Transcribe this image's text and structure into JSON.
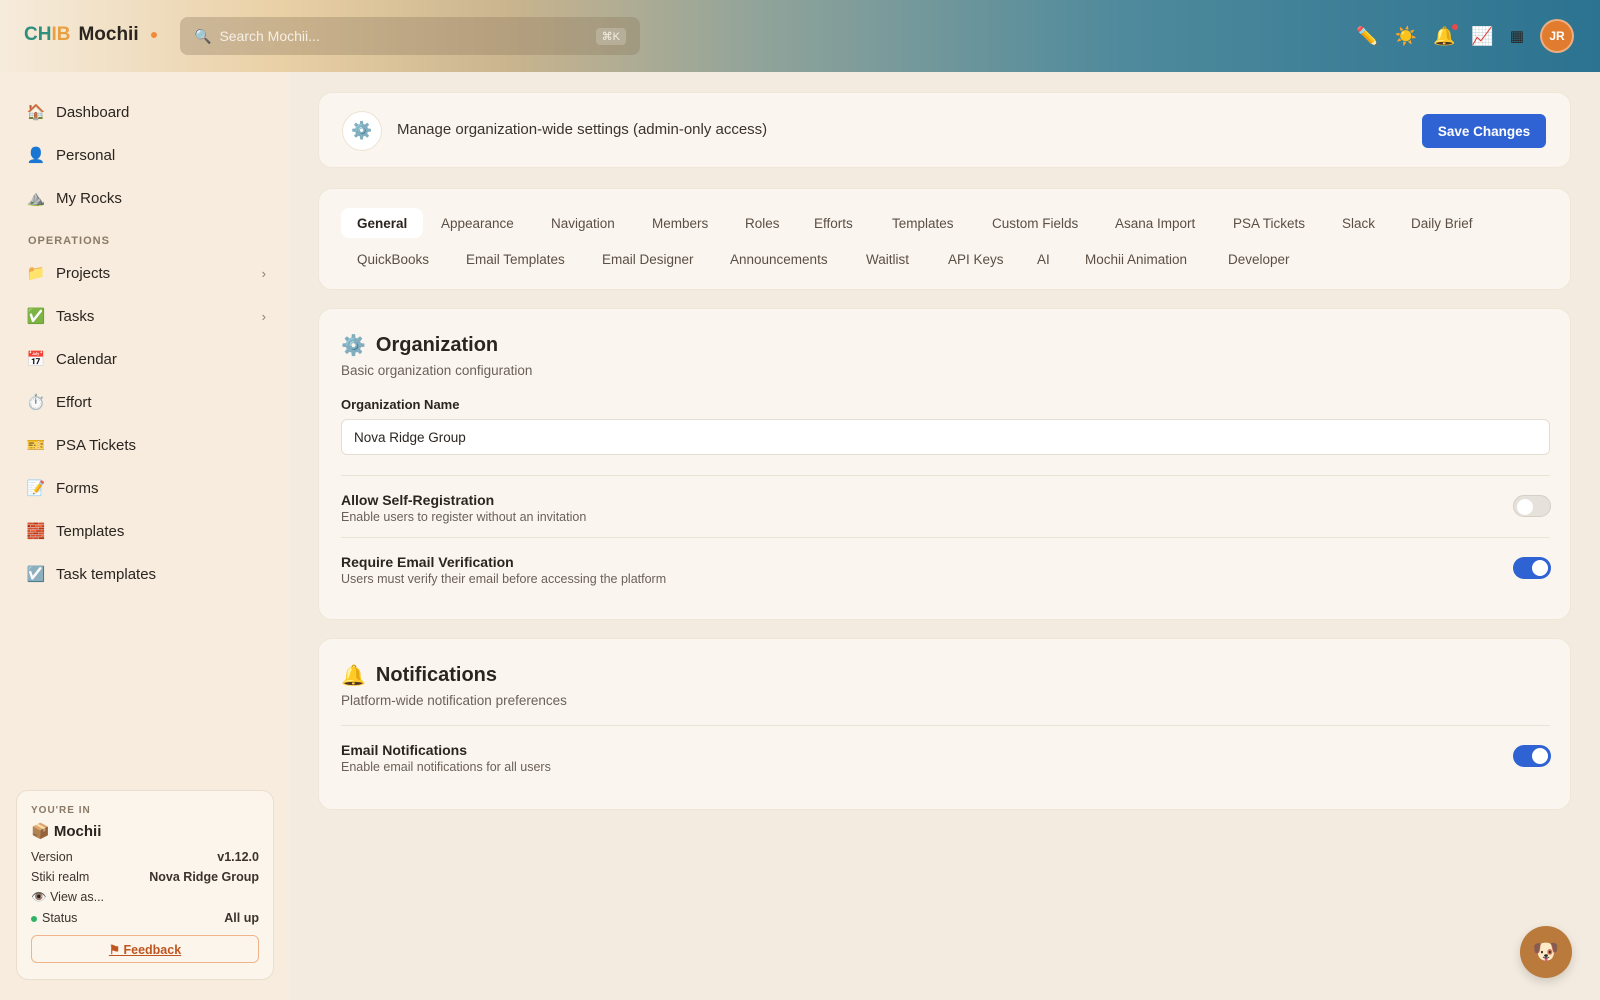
{
  "brand": {
    "part1": "CH",
    "part2": "IB",
    "name": "Mochii"
  },
  "search": {
    "placeholder": "Search Mochii...",
    "shortcut": "⌘K"
  },
  "user": {
    "initials": "JR"
  },
  "sidebar": {
    "items": [
      {
        "label": "Dashboard",
        "icon": "house-icon"
      },
      {
        "label": "Personal",
        "icon": "person-icon"
      },
      {
        "label": "My Rocks",
        "icon": "mountain-icon"
      }
    ],
    "section_label": "OPERATIONS",
    "ops_items": [
      {
        "label": "Projects",
        "icon": "folder-icon"
      },
      {
        "label": "Tasks",
        "icon": "checkbox-icon"
      },
      {
        "label": "Calendar",
        "icon": "calendar-icon"
      },
      {
        "label": "Effort",
        "icon": "stopwatch-icon"
      },
      {
        "label": "PSA Tickets",
        "icon": "ticket-icon"
      },
      {
        "label": "Forms",
        "icon": "memo-icon"
      },
      {
        "label": "Templates",
        "icon": "bricks-icon"
      },
      {
        "label": "Task templates",
        "icon": "ballot-check-icon"
      }
    ]
  },
  "context": {
    "label": "YOU'RE IN",
    "name": "Mochii",
    "version_label": "Version",
    "version": "v1.12.0",
    "realm_label": "Stiki realm",
    "realm": "Nova Ridge Group",
    "view_as": "View as...",
    "status_label": "Status",
    "status": "All up",
    "feedback": "⚑ Feedback"
  },
  "header": {
    "text": "Manage organization-wide settings (admin-only access)",
    "save_label": "Save Changes"
  },
  "tabs": {
    "row1": [
      "General",
      "Appearance",
      "Navigation",
      "Members",
      "Roles",
      "Efforts",
      "Templates",
      "Custom Fields",
      "Asana Import",
      "PSA Tickets",
      "Slack",
      "Daily Brief"
    ],
    "row2": [
      "QuickBooks",
      "Email Templates",
      "Email Designer",
      "Announcements",
      "Waitlist",
      "API Keys",
      "AI",
      "Mochii Animation",
      "Developer"
    ],
    "active": "General"
  },
  "organization": {
    "title": "Organization",
    "subtitle": "Basic organization configuration",
    "name_label": "Organization Name",
    "name_value": "Nova Ridge Group",
    "self_reg": {
      "title": "Allow Self-Registration",
      "desc": "Enable users to register without an invitation",
      "enabled": false
    },
    "email_verif": {
      "title": "Require Email Verification",
      "desc": "Users must verify their email before accessing the platform",
      "enabled": true
    }
  },
  "notifications": {
    "title": "Notifications",
    "subtitle": "Platform-wide notification preferences",
    "email": {
      "title": "Email Notifications",
      "desc": "Enable email notifications for all users",
      "enabled": true
    }
  }
}
